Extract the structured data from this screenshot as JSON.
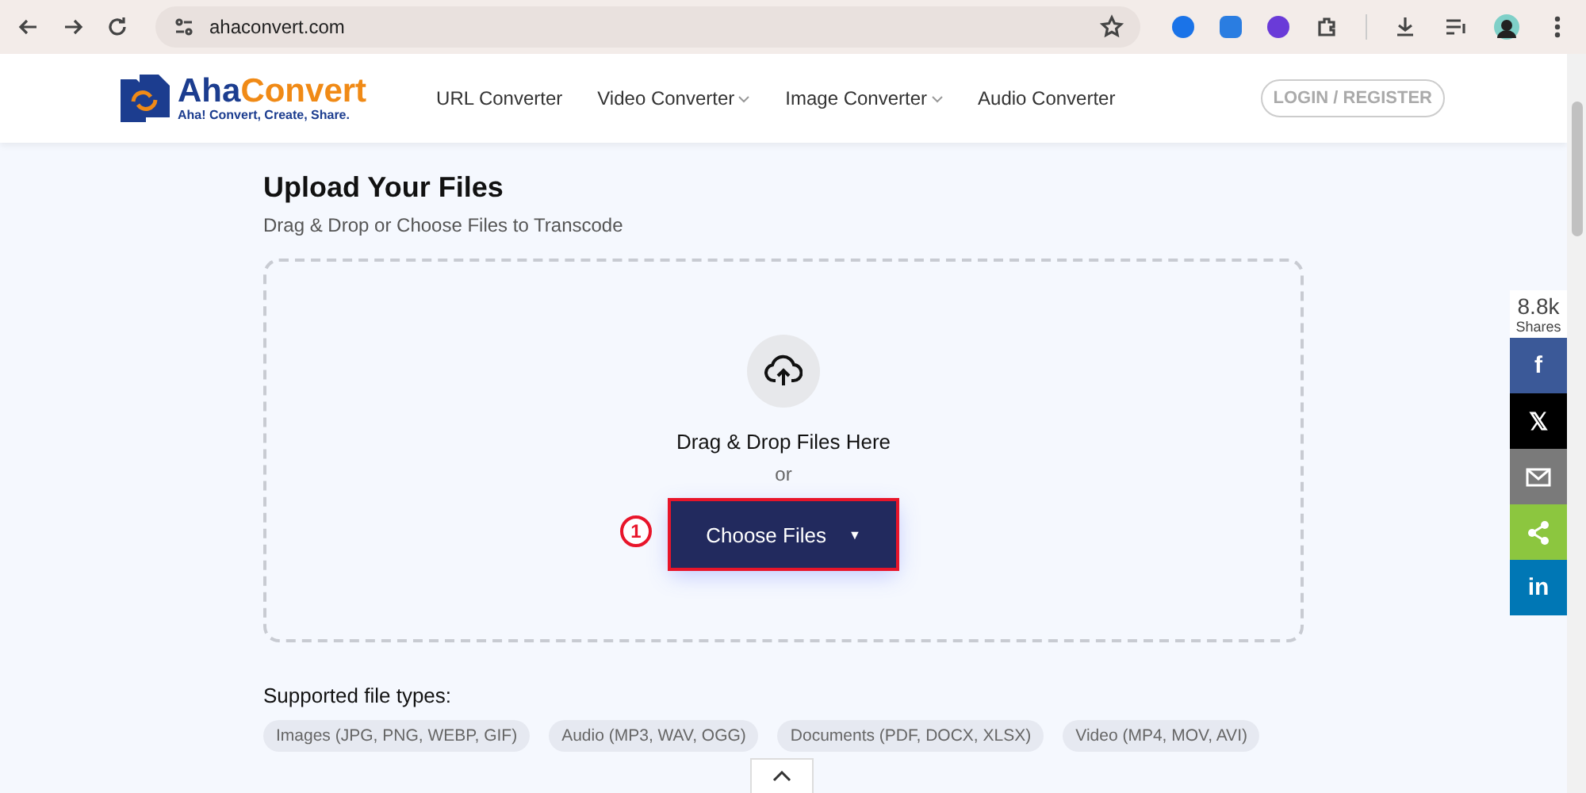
{
  "browser": {
    "url": "ahaconvert.com"
  },
  "header": {
    "logo_name": "AhaConvert",
    "logo_tagline": "Aha! Convert, Create, Share.",
    "nav": [
      {
        "label": "URL Converter",
        "dropdown": false
      },
      {
        "label": "Video Converter",
        "dropdown": true
      },
      {
        "label": "Image Converter",
        "dropdown": true
      },
      {
        "label": "Audio Converter",
        "dropdown": false
      }
    ],
    "login": "LOGIN / REGISTER"
  },
  "upload": {
    "title": "Upload Your Files",
    "subtitle": "Drag & Drop or Choose Files to Transcode",
    "drop_text": "Drag & Drop Files Here",
    "or": "or",
    "button": "Choose Files",
    "caret": "▼",
    "annotation": "1"
  },
  "supported": {
    "title": "Supported file types:",
    "types": [
      "Images (JPG, PNG, WEBP, GIF)",
      "Audio (MP3, WAV, OGG)",
      "Documents (PDF, DOCX, XLSX)",
      "Video (MP4, MOV, AVI)"
    ]
  },
  "share": {
    "count": "8.8k",
    "label": "Shares",
    "buttons": [
      {
        "kind": "facebook",
        "text": "f"
      },
      {
        "kind": "x",
        "text": "𝕏"
      },
      {
        "kind": "email"
      },
      {
        "kind": "share"
      },
      {
        "kind": "linkedin",
        "text": "in"
      }
    ]
  }
}
